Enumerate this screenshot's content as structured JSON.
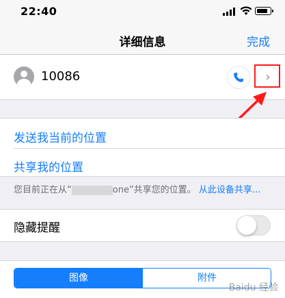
{
  "status_bar": {
    "time": "22:40",
    "signal_icon": "signal-icon",
    "wifi_icon": "wifi-icon",
    "battery_level": 0.85
  },
  "nav": {
    "title": "详细信息",
    "done_label": "完成"
  },
  "contact": {
    "name": "10086",
    "avatar_icon": "avatar-icon",
    "call_icon": "phone-icon",
    "info_icon": "chevron-right-icon"
  },
  "location": {
    "send_current_label": "发送我当前的位置",
    "share_label": "共享我的位置",
    "footnote_prefix": "您目前正在从“",
    "footnote_suffix": "one”共享您的位置。",
    "footnote_link": "从此设备共享..."
  },
  "hide_alerts": {
    "label": "隐藏提醒",
    "enabled": false
  },
  "segments": {
    "images_label": "图像",
    "attachments_label": "附件"
  },
  "watermark": "Baidu 经验",
  "colors": {
    "accent": "#147efb",
    "annotation": "#ff1a1a"
  }
}
